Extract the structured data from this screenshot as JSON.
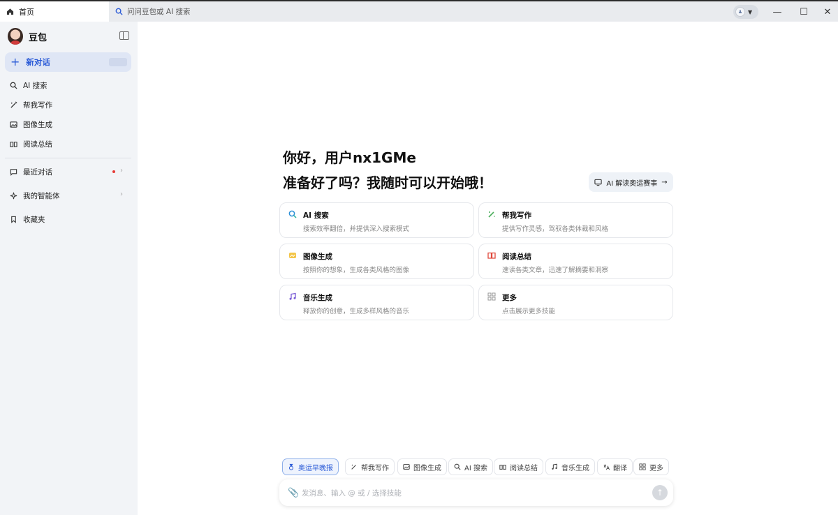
{
  "titlebar": {
    "home_tab": "首页",
    "search_tab": "问问豆包或 AI 搜索"
  },
  "sidebar": {
    "brand": "豆包",
    "new_chat": "新对话",
    "items": [
      {
        "label": "AI 搜索",
        "icon": "search-icon"
      },
      {
        "label": "帮我写作",
        "icon": "pen-icon"
      },
      {
        "label": "图像生成",
        "icon": "image-icon"
      },
      {
        "label": "阅读总结",
        "icon": "book-icon"
      }
    ],
    "recent": "最近对话",
    "agents": "我的智能体",
    "favorites": "收藏夹"
  },
  "main": {
    "greeting": "你好，用户nx1GMe",
    "prompt": "准备好了吗？我随时可以开始哦！",
    "promo_button": "AI 解读奥运赛事",
    "cards": [
      {
        "title": "AI 搜索",
        "desc": "搜索效率翻倍，并提供深入搜索模式",
        "icon": "search-icon"
      },
      {
        "title": "帮我写作",
        "desc": "提供写作灵感，驾驭各类体裁和风格",
        "icon": "pen-icon"
      },
      {
        "title": "图像生成",
        "desc": "按照你的想象，生成各类风格的图像",
        "icon": "image-icon"
      },
      {
        "title": "阅读总结",
        "desc": "速读各类文章，迅速了解摘要和洞察",
        "icon": "book-icon"
      },
      {
        "title": "音乐生成",
        "desc": "释放你的创意，生成多样风格的音乐",
        "icon": "music-icon"
      },
      {
        "title": "更多",
        "desc": "点击展示更多技能",
        "icon": "grid-icon"
      }
    ]
  },
  "chips": [
    "奥运早晚报",
    "帮我写作",
    "图像生成",
    "AI 搜索",
    "阅读总结",
    "音乐生成",
    "翻译",
    "更多"
  ],
  "composer": {
    "placeholder": "发消息、输入 @ 或 / 选择技能"
  },
  "colors": {
    "accent": "#2b5bd7",
    "sidebar_bg": "#f2f4f7"
  }
}
